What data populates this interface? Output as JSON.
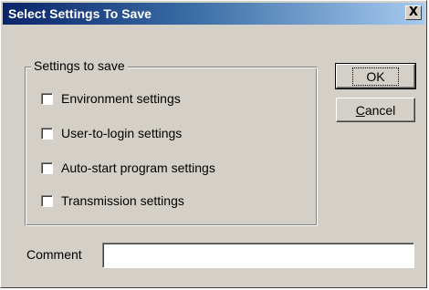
{
  "window": {
    "title": "Select  Settings To Save",
    "close_glyph": "X"
  },
  "group": {
    "legend": "Settings to save",
    "items": [
      {
        "label": "Environment settings",
        "checked": false
      },
      {
        "label": "User-to-login settings",
        "checked": false
      },
      {
        "label": "Auto-start program settings",
        "checked": false
      },
      {
        "label": "Transmission settings",
        "checked": false
      }
    ]
  },
  "buttons": {
    "ok_label": "OK",
    "cancel_first": "C",
    "cancel_rest": "ancel"
  },
  "comment": {
    "label": "Comment",
    "value": ""
  }
}
